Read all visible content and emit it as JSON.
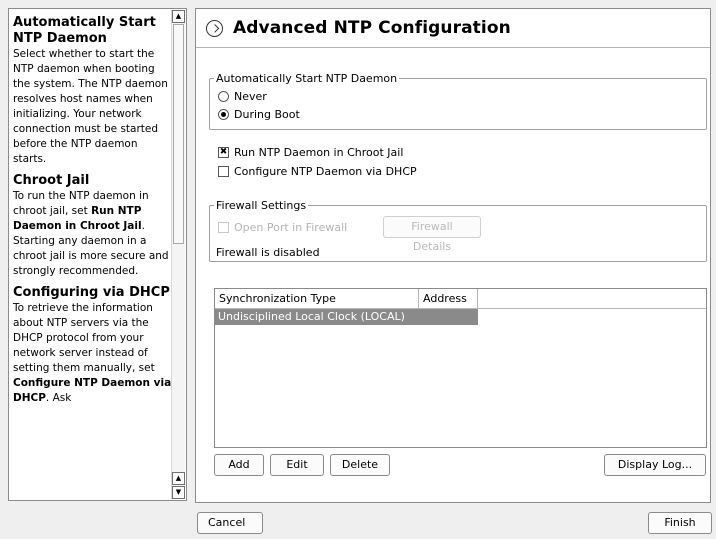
{
  "help": {
    "sections": [
      {
        "title": "Automatically Start NTP Daemon",
        "body": "Select whether to start the NTP daemon when booting the system. The NTP daemon resolves host names when initializing. Your network connection must be started before the NTP daemon starts."
      },
      {
        "title": "Chroot Jail",
        "body_pre": "To run the NTP daemon in chroot jail, set ",
        "body_bold": "Run NTP Daemon in Chroot Jail",
        "body_post": ". Starting any daemon in a chroot jail is more secure and strongly recommended."
      },
      {
        "title": "Configuring via DHCP",
        "body_pre": "To retrieve the information about NTP servers via the DHCP protocol from your network server instead of setting them manually, set ",
        "body_bold": "Configure NTP Daemon via DHCP",
        "body_post": ". Ask"
      }
    ]
  },
  "dialog": {
    "title": "Advanced NTP Configuration",
    "start_group": {
      "legend": "Automatically Start NTP Daemon",
      "options": [
        {
          "label": "Never",
          "selected": false
        },
        {
          "label": "During Boot",
          "selected": true
        }
      ]
    },
    "checkboxes": [
      {
        "label": "Run NTP Daemon in Chroot Jail",
        "checked": true
      },
      {
        "label": "Configure NTP Daemon via DHCP",
        "checked": false
      }
    ],
    "firewall": {
      "legend": "Firewall Settings",
      "open_port_label": "Open Port in Firewall",
      "details_label": "Firewall Details",
      "status": "Firewall is disabled"
    },
    "table": {
      "columns": [
        "Synchronization Type",
        "Address"
      ],
      "rows": [
        {
          "type": "Undisciplined Local Clock (LOCAL)",
          "address": ""
        }
      ]
    },
    "buttons": {
      "add": "Add",
      "edit": "Edit",
      "delete": "Delete",
      "display_log": "Display Log..."
    }
  },
  "footer": {
    "cancel": "Cancel",
    "finish": "Finish"
  }
}
